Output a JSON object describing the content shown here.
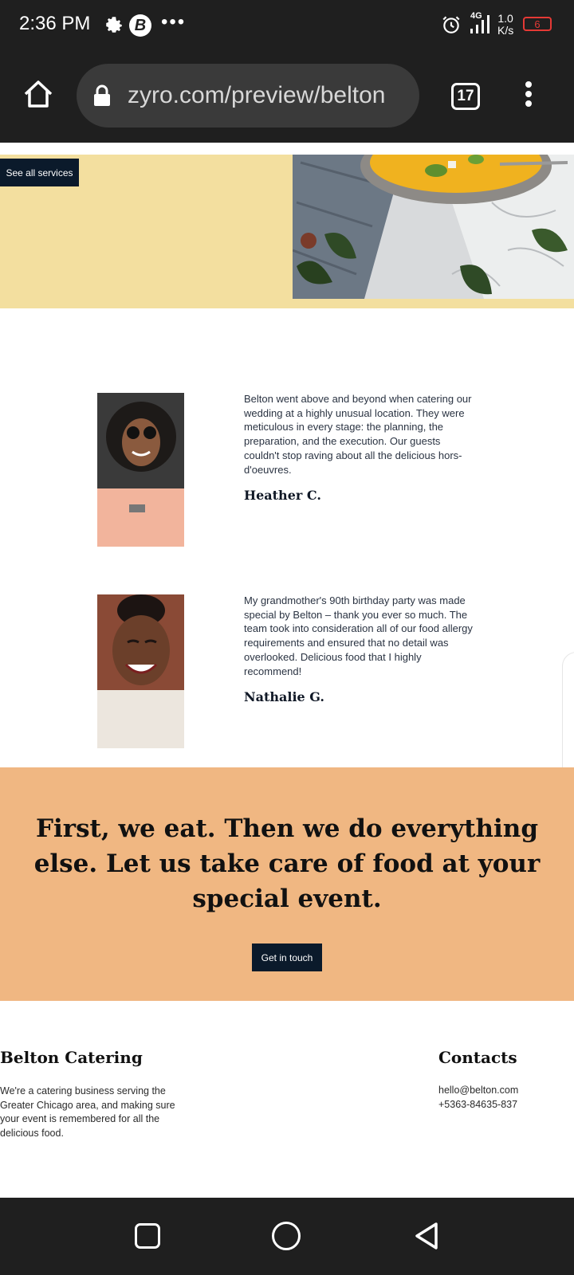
{
  "status_bar": {
    "time": "2:36 PM",
    "network": "4G",
    "speed_value": "1.0",
    "speed_unit": "K/s",
    "battery": "6"
  },
  "browser": {
    "url": "zyro.com/preview/belton",
    "tab_count": "17"
  },
  "services": {
    "button_label": "See all services"
  },
  "testimonials": [
    {
      "quote": "Belton went above and beyond when catering our wedding at a highly unusual location. They were meticulous in every stage: the planning, the preparation, and the execution. Our guests couldn't stop raving about all the delicious hors-d'oeuvres.",
      "author": "Heather C."
    },
    {
      "quote": "My grandmother's 90th birthday party was made special by Belton – thank you ever so much. The team took into consideration all of our food allergy requirements and ensured that no detail was overlooked. Delicious food that I highly recommend!",
      "author": "Nathalie G."
    }
  ],
  "cta": {
    "heading": "First, we eat. Then we do everything else. Let us take care of food at your special event.",
    "button_label": "Get in touch"
  },
  "footer": {
    "brand_title": "Belton Catering",
    "brand_description": "We're a catering business serving the Greater Chicago area, and making sure your event is remembered for all the delicious food.",
    "contacts_title": "Contacts",
    "email": "hello@belton.com",
    "phone": "+5363-84635-837"
  },
  "colors": {
    "yellow_band": "#f3df9f",
    "peach_band": "#f0b782",
    "navy_button": "#0b1a2b",
    "system_bar": "#1f1f1f",
    "battery_red": "#e53935"
  },
  "icons": [
    "gear-icon",
    "b-badge-icon",
    "more-dots-icon",
    "alarm-icon",
    "signal-icon",
    "battery-icon",
    "home-icon",
    "lock-icon",
    "tabs-icon",
    "overflow-menu-icon",
    "recents-icon",
    "nav-home-icon",
    "back-icon"
  ]
}
